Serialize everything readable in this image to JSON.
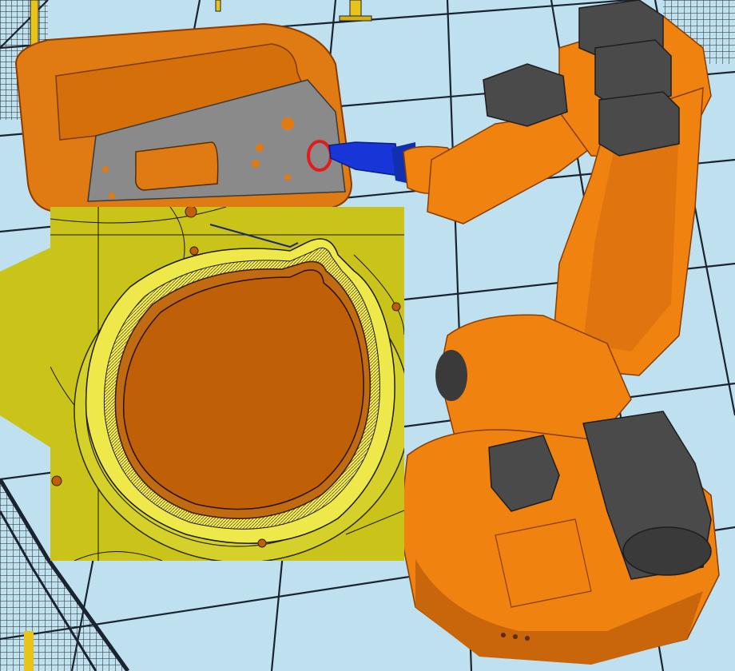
{
  "scene": {
    "colors": {
      "floor": "#bfe0ef",
      "grid": "#1a2330",
      "robot": "#f0820f",
      "robot_dark": "#c9650a",
      "robot_shadow": "#a84f05",
      "motor": "#4a4a4a",
      "motor_light": "#6a6a6a",
      "part_orange": "#e07a12",
      "part_gray": "#8a8a8a",
      "tool_blue": "#1836d8",
      "target_red": "#e41b1b",
      "inset_bg": "#c9c31a",
      "inset_rim": "#e8e23a",
      "inset_hole": "#bf6008",
      "fence_yellow": "#e8c41a"
    }
  }
}
